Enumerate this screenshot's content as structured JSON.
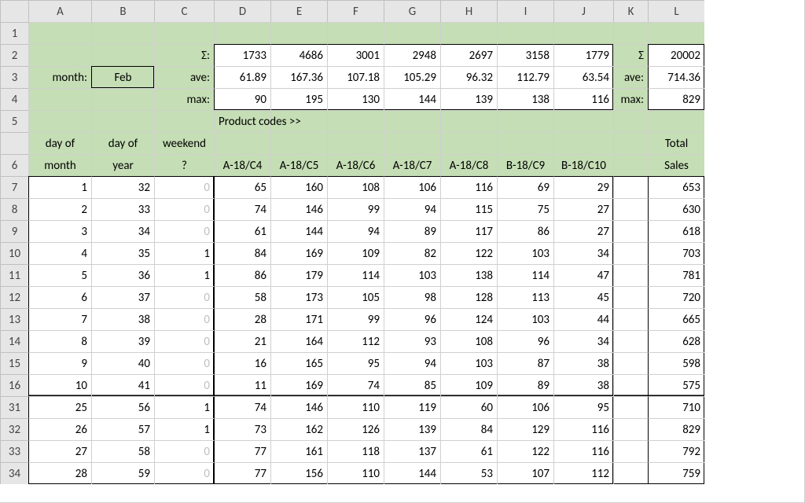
{
  "columns": [
    "",
    "A",
    "B",
    "C",
    "D",
    "E",
    "F",
    "G",
    "H",
    "I",
    "J",
    "K",
    "L"
  ],
  "row_numbers_top": [
    "1",
    "2",
    "3",
    "4",
    "5",
    "6",
    "7",
    "8",
    "9",
    "10",
    "11",
    "12",
    "13",
    "14",
    "15",
    "16"
  ],
  "row_numbers_bottom": [
    "31",
    "32",
    "33",
    "34"
  ],
  "labels": {
    "month": "month:",
    "month_value": "Feb",
    "sigma": "Σ:",
    "ave": "ave:",
    "max": "max:",
    "sigma2": "Σ",
    "ave2": "ave:",
    "max2": "max:",
    "product_codes": "Product codes >>",
    "day_of_month_1": "day of",
    "day_of_month_2": "month",
    "day_of_year_1": "day of",
    "day_of_year_2": "year",
    "weekend_1": "weekend",
    "weekend_2": "?",
    "total_1": "Total",
    "total_2": "Sales"
  },
  "stats": {
    "sum": [
      "1733",
      "4686",
      "3001",
      "2948",
      "2697",
      "3158",
      "1779"
    ],
    "ave": [
      "61.89",
      "167.36",
      "107.18",
      "105.29",
      "96.32",
      "112.79",
      "63.54"
    ],
    "max": [
      "90",
      "195",
      "130",
      "144",
      "139",
      "138",
      "116"
    ],
    "grand_sum": "20002",
    "grand_ave": "714.36",
    "grand_max": "829"
  },
  "product_headers": [
    "A-18/C4",
    "A-18/C5",
    "A-18/C6",
    "A-18/C7",
    "A-18/C8",
    "B-18/C9",
    "B-18/C10"
  ],
  "data_top": [
    {
      "dom": "1",
      "doy": "32",
      "we": "0",
      "v": [
        "65",
        "160",
        "108",
        "106",
        "116",
        "69",
        "29"
      ],
      "tot": "653"
    },
    {
      "dom": "2",
      "doy": "33",
      "we": "0",
      "v": [
        "74",
        "146",
        "99",
        "94",
        "115",
        "75",
        "27"
      ],
      "tot": "630"
    },
    {
      "dom": "3",
      "doy": "34",
      "we": "0",
      "v": [
        "61",
        "144",
        "94",
        "89",
        "117",
        "86",
        "27"
      ],
      "tot": "618"
    },
    {
      "dom": "4",
      "doy": "35",
      "we": "1",
      "v": [
        "84",
        "169",
        "109",
        "82",
        "122",
        "103",
        "34"
      ],
      "tot": "703"
    },
    {
      "dom": "5",
      "doy": "36",
      "we": "1",
      "v": [
        "86",
        "179",
        "114",
        "103",
        "138",
        "114",
        "47"
      ],
      "tot": "781"
    },
    {
      "dom": "6",
      "doy": "37",
      "we": "0",
      "v": [
        "58",
        "173",
        "105",
        "98",
        "128",
        "113",
        "45"
      ],
      "tot": "720"
    },
    {
      "dom": "7",
      "doy": "38",
      "we": "0",
      "v": [
        "28",
        "171",
        "99",
        "96",
        "124",
        "103",
        "44"
      ],
      "tot": "665"
    },
    {
      "dom": "8",
      "doy": "39",
      "we": "0",
      "v": [
        "21",
        "164",
        "112",
        "93",
        "108",
        "96",
        "34"
      ],
      "tot": "628"
    },
    {
      "dom": "9",
      "doy": "40",
      "we": "0",
      "v": [
        "16",
        "165",
        "95",
        "94",
        "103",
        "87",
        "38"
      ],
      "tot": "598"
    },
    {
      "dom": "10",
      "doy": "41",
      "we": "0",
      "v": [
        "11",
        "169",
        "74",
        "85",
        "109",
        "89",
        "38"
      ],
      "tot": "575"
    }
  ],
  "data_bottom": [
    {
      "dom": "25",
      "doy": "56",
      "we": "1",
      "v": [
        "74",
        "146",
        "110",
        "119",
        "60",
        "106",
        "95"
      ],
      "tot": "710"
    },
    {
      "dom": "26",
      "doy": "57",
      "we": "1",
      "v": [
        "73",
        "162",
        "126",
        "139",
        "84",
        "129",
        "116"
      ],
      "tot": "829"
    },
    {
      "dom": "27",
      "doy": "58",
      "we": "0",
      "v": [
        "77",
        "161",
        "118",
        "137",
        "61",
        "122",
        "116"
      ],
      "tot": "792"
    },
    {
      "dom": "28",
      "doy": "59",
      "we": "0",
      "v": [
        "77",
        "156",
        "110",
        "144",
        "53",
        "107",
        "112"
      ],
      "tot": "759"
    }
  ],
  "chart_data": {
    "type": "table",
    "title": "Product sales by day (Feb)",
    "columns": [
      "day of month",
      "day of year",
      "weekend?",
      "A-18/C4",
      "A-18/C5",
      "A-18/C6",
      "A-18/C7",
      "A-18/C8",
      "B-18/C9",
      "B-18/C10",
      "Total Sales"
    ],
    "rows_visible_top": [
      [
        1,
        32,
        0,
        65,
        160,
        108,
        106,
        116,
        69,
        29,
        653
      ],
      [
        2,
        33,
        0,
        74,
        146,
        99,
        94,
        115,
        75,
        27,
        630
      ],
      [
        3,
        34,
        0,
        61,
        144,
        94,
        89,
        117,
        86,
        27,
        618
      ],
      [
        4,
        35,
        1,
        84,
        169,
        109,
        82,
        122,
        103,
        34,
        703
      ],
      [
        5,
        36,
        1,
        86,
        179,
        114,
        103,
        138,
        114,
        47,
        781
      ],
      [
        6,
        37,
        0,
        58,
        173,
        105,
        98,
        128,
        113,
        45,
        720
      ],
      [
        7,
        38,
        0,
        28,
        171,
        99,
        96,
        124,
        103,
        44,
        665
      ],
      [
        8,
        39,
        0,
        21,
        164,
        112,
        93,
        108,
        96,
        34,
        628
      ],
      [
        9,
        40,
        0,
        16,
        165,
        95,
        94,
        103,
        87,
        38,
        598
      ],
      [
        10,
        41,
        0,
        11,
        169,
        74,
        85,
        109,
        89,
        38,
        575
      ]
    ],
    "rows_visible_bottom": [
      [
        25,
        56,
        1,
        74,
        146,
        110,
        119,
        60,
        106,
        95,
        710
      ],
      [
        26,
        57,
        1,
        73,
        162,
        126,
        139,
        84,
        129,
        116,
        829
      ],
      [
        27,
        58,
        0,
        77,
        161,
        118,
        137,
        61,
        122,
        116,
        792
      ],
      [
        28,
        59,
        0,
        77,
        156,
        110,
        144,
        53,
        107,
        112,
        759
      ]
    ],
    "column_sums_D_to_J": [
      1733,
      4686,
      3001,
      2948,
      2697,
      3158,
      1779
    ],
    "column_aves_D_to_J": [
      61.89,
      167.36,
      107.18,
      105.29,
      96.32,
      112.79,
      63.54
    ],
    "column_maxs_D_to_J": [
      90,
      195,
      130,
      144,
      139,
      138,
      116
    ],
    "grand_total_sum": 20002,
    "grand_total_ave": 714.36,
    "grand_total_max": 829
  }
}
